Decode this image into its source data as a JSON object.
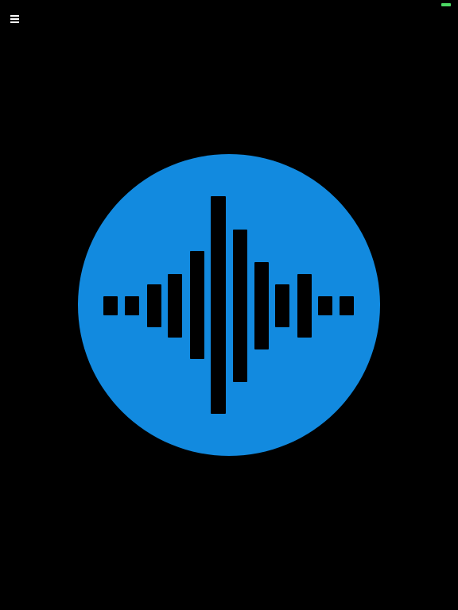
{
  "colors": {
    "background": "#000000",
    "button_fill": "#128ADF",
    "bars": "#000000",
    "menu_icon": "#FFFFFF",
    "battery": "#4CD964"
  },
  "icons": {
    "menu": "hamburger-menu-icon",
    "listen": "sound-wave-icon"
  }
}
